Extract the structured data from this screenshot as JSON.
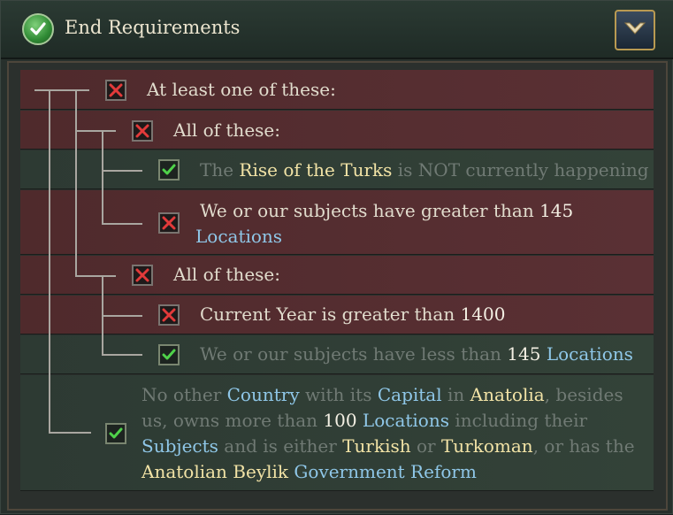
{
  "header": {
    "title": "End Requirements",
    "status_icon": "green-check-icon",
    "collapse_icon": "chevron-down-icon"
  },
  "colors": {
    "fail_row": "#532c2f",
    "met_row": "#304036",
    "highlight_text": "#f2e3a6",
    "link_text": "#8fc7e8",
    "dim_text": "#707a74"
  },
  "requirements": {
    "root": {
      "label": "At least one of these:",
      "met": false
    },
    "group1": {
      "label": "All of these:",
      "met": false
    },
    "g1_item1": {
      "met": true,
      "p1": "The ",
      "p2": "Rise of the Turks",
      "p3": " is NOT currently happening"
    },
    "g1_item2": {
      "met": false,
      "p1": "We or our subjects have greater than ",
      "p2": "145",
      "p3": "Locations"
    },
    "group2": {
      "label": "All of these:",
      "met": false
    },
    "g2_item1": {
      "met": false,
      "p1": "Current Year is greater than ",
      "p2": "1400"
    },
    "g2_item2": {
      "met": true,
      "p1": "We or our subjects have less than ",
      "p2": "145",
      "p3": " ",
      "p4": "Locations"
    },
    "item3": {
      "met": true,
      "t1": "No other ",
      "t2": "Country",
      "t3": " with its ",
      "t4": "Capital",
      "t5": " in ",
      "t6": "Anatolia",
      "t7": ", besides us, owns more than ",
      "t8": "100",
      "t9": " ",
      "t10": "Locations",
      "t11": " including their ",
      "t12": "Subjects",
      "t13": " and is either ",
      "t14": "Turkish",
      "t15": " or ",
      "t16": "Turkoman",
      "t17": ", or has the ",
      "t18": "Anatolian Beylik",
      "t19": " ",
      "t20": "Government Reform"
    }
  }
}
